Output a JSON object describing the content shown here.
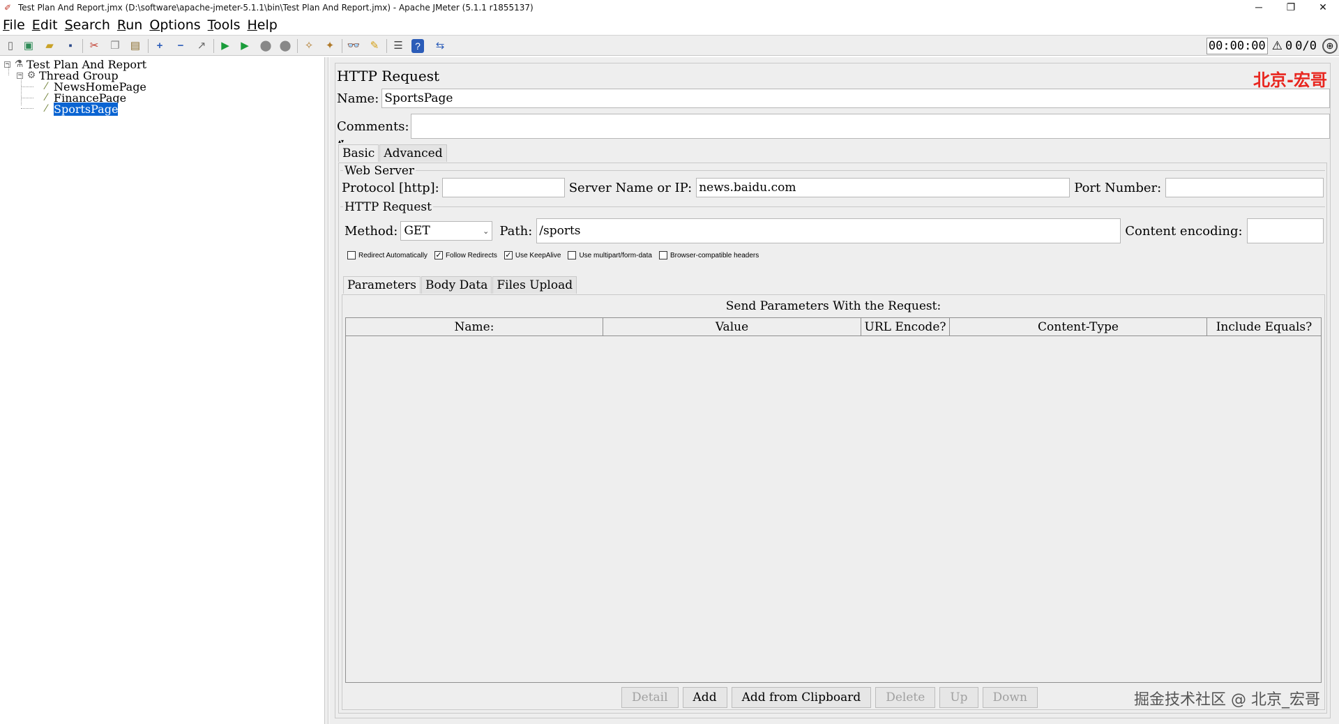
{
  "window": {
    "title": "Test Plan And Report.jmx (D:\\software\\apache-jmeter-5.1.1\\bin\\Test Plan And Report.jmx) - Apache JMeter (5.1.1 r1855137)",
    "minimize": "─",
    "maximize": "❐",
    "close": "✕"
  },
  "menu": [
    "File",
    "Edit",
    "Search",
    "Run",
    "Options",
    "Tools",
    "Help"
  ],
  "toolbar": {
    "timer": "00:00:00",
    "warning_count": "0",
    "threads": "0/0",
    "icons": [
      "new-icon",
      "templates-icon",
      "open-icon",
      "save-icon",
      "cut-icon",
      "copy-icon",
      "paste-icon",
      "expand-icon",
      "collapse-icon",
      "toggle-icon",
      "start-icon",
      "start-no-pause-icon",
      "stop-icon",
      "shutdown-icon",
      "clear-icon",
      "clear-all-icon",
      "search-icon",
      "reset-search-icon",
      "function-helper-icon",
      "help-icon",
      "remote-icon"
    ]
  },
  "tree": {
    "nodes": [
      {
        "label": "Test Plan And Report",
        "icon": "test-plan-icon",
        "level": 0,
        "toggle": "−"
      },
      {
        "label": "Thread Group",
        "icon": "gear-icon",
        "level": 1,
        "toggle": "−"
      },
      {
        "label": "NewsHomePage",
        "icon": "pipette-icon",
        "level": 2
      },
      {
        "label": "FinancePage",
        "icon": "pipette-icon",
        "level": 2
      },
      {
        "label": "SportsPage",
        "icon": "pipette-icon",
        "level": 2,
        "selected": true
      }
    ]
  },
  "panel": {
    "title": "HTTP Request",
    "watermark": "北京-宏哥",
    "name_label": "Name:",
    "name_value": "SportsPage",
    "comments_label": "Comments:",
    "comments_value": "",
    "tabs": [
      "Basic",
      "Advanced"
    ],
    "web_server": {
      "legend": "Web Server",
      "protocol_label": "Protocol [http]:",
      "protocol_value": "",
      "server_label": "Server Name or IP:",
      "server_value": "news.baidu.com",
      "port_label": "Port Number:",
      "port_value": ""
    },
    "http_request": {
      "legend": "HTTP Request",
      "method_label": "Method:",
      "method_value": "GET",
      "path_label": "Path:",
      "path_value": "/sports",
      "encoding_label": "Content encoding:",
      "encoding_value": ""
    },
    "checkboxes": [
      {
        "label": "Redirect Automatically",
        "checked": false
      },
      {
        "label": "Follow Redirects",
        "checked": true
      },
      {
        "label": "Use KeepAlive",
        "checked": true
      },
      {
        "label": "Use multipart/form-data",
        "checked": false
      },
      {
        "label": "Browser-compatible headers",
        "checked": false
      }
    ],
    "sub_tabs": [
      "Parameters",
      "Body Data",
      "Files Upload"
    ],
    "table_caption": "Send Parameters With the Request:",
    "columns": [
      "Name:",
      "Value",
      "URL Encode?",
      "Content-Type",
      "Include Equals?"
    ],
    "buttons": [
      {
        "label": "Detail",
        "enabled": false
      },
      {
        "label": "Add",
        "enabled": true
      },
      {
        "label": "Add from Clipboard",
        "enabled": true
      },
      {
        "label": "Delete",
        "enabled": false
      },
      {
        "label": "Up",
        "enabled": false
      },
      {
        "label": "Down",
        "enabled": false
      }
    ],
    "bottom_watermark": "掘金技术社区 @ 北京_宏哥"
  }
}
